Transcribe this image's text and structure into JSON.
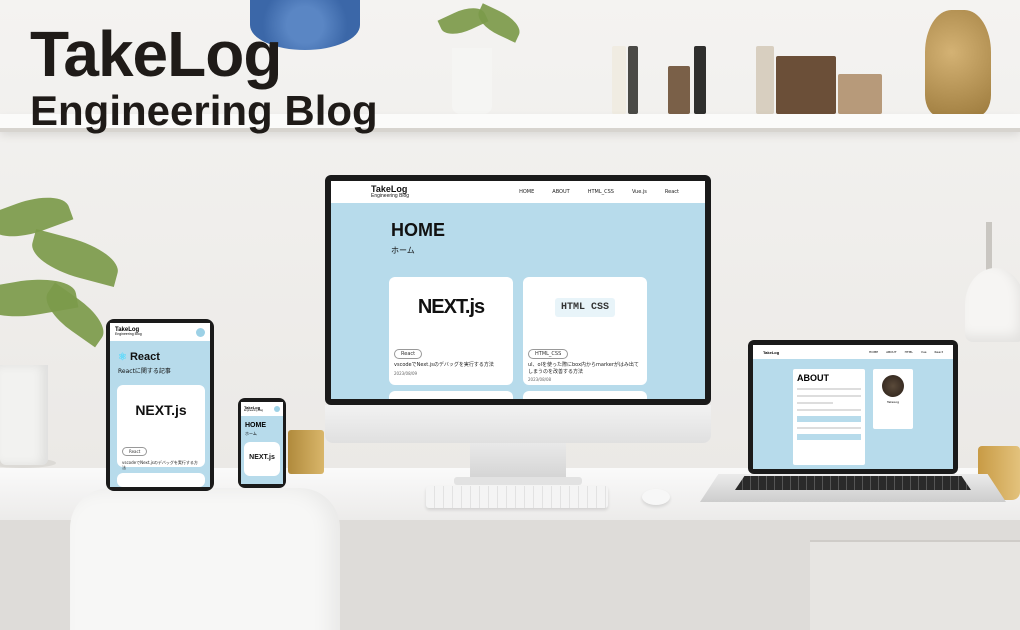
{
  "brand": {
    "title": "TakeLog",
    "subtitle": "Engineering Blog"
  },
  "monitor": {
    "brand_title": "TakeLog",
    "brand_sub": "Engineering Blog",
    "nav": [
      "HOME",
      "ABOUT",
      "HTML_CSS",
      "Vue.js",
      "React"
    ],
    "heading": "HOME",
    "subheading": "ホーム",
    "cards": [
      {
        "thumb": "NEXT.js",
        "tag": "React",
        "title": "vscodeでNext.jsのデバッグを実行する方法",
        "date": "2023/08/09"
      },
      {
        "thumb": "HTML CSS",
        "tag": "HTML_CSS",
        "title": "ul、olを使った際にbox内からmarkerがはみ出てしまうのを改善する方法",
        "date": "2023/08/08"
      }
    ]
  },
  "tablet": {
    "brand_title": "TakeLog",
    "brand_sub": "Engineering Blog",
    "heading": "React",
    "subheading": "Reactに関する記事",
    "card_thumb": "NEXT.js",
    "card_tag": "React",
    "card_title": "vscodeでNext.jsのデバッグを実行する方法"
  },
  "phone": {
    "brand_title": "TakeLog",
    "brand_sub": "Engineering Blog",
    "heading": "HOME",
    "subheading": "ホーム",
    "card_thumb": "NEXT.js"
  },
  "laptop": {
    "brand_title": "TakeLog",
    "nav": [
      "HOME",
      "ABOUT",
      "HTML",
      "Vue",
      "React"
    ],
    "heading": "ABOUT",
    "profile_name": "TakeLog"
  },
  "colors": {
    "screen_bg": "#b7dbeb",
    "logo_text": "#1f1b18",
    "accent": "#9dd1e6"
  }
}
